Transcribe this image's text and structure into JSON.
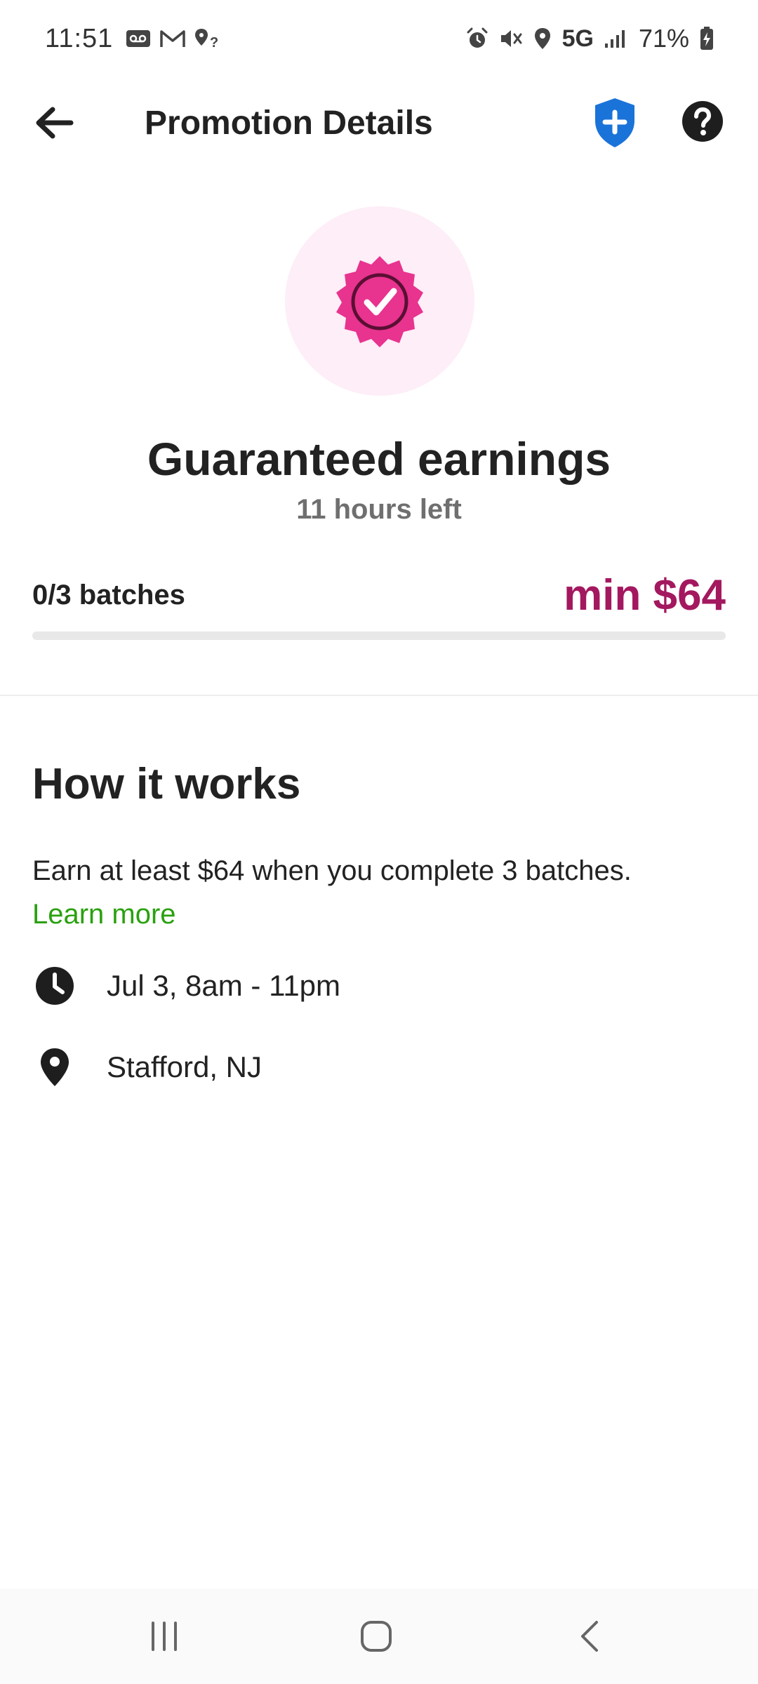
{
  "status_bar": {
    "time": "11:51",
    "network": "5G",
    "battery": "71%",
    "icons_left": [
      "voicemail-icon",
      "gmail-icon",
      "location-question-icon"
    ],
    "icons_right": [
      "alarm-icon",
      "mute-icon",
      "location-icon",
      "signal-icon",
      "battery-icon"
    ]
  },
  "app_bar": {
    "title": "Promotion Details",
    "back_icon": "arrow-left-icon",
    "safety_icon": "shield-plus-icon",
    "help_icon": "help-circle-icon",
    "safety_color": "#1a73d9"
  },
  "promotion": {
    "badge_icon": "verified-badge-icon",
    "badge_color": "#e8338f",
    "title": "Guaranteed earnings",
    "time_left": "11 hours left",
    "batches_progress": "0/3 batches",
    "progress_fraction": 0.0,
    "min_amount": "min $64",
    "accent_color": "#a3185f"
  },
  "how_it_works": {
    "title": "How it works",
    "description": "Earn at least $64 when you complete 3 batches.",
    "learn_more": "Learn more",
    "link_color": "#2aa10f",
    "schedule": "Jul 3, 8am - 11pm",
    "schedule_icon": "clock-icon",
    "location": "Stafford, NJ",
    "location_icon": "map-pin-icon"
  },
  "nav_bar": {
    "items": [
      "recent-apps-icon",
      "home-icon",
      "back-icon"
    ]
  }
}
